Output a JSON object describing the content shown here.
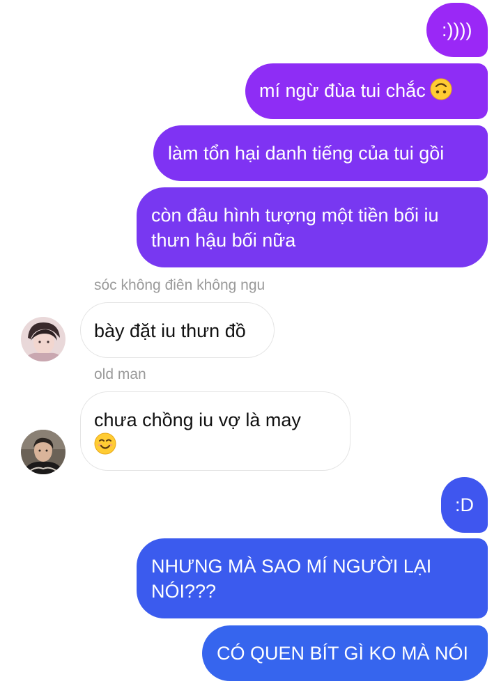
{
  "messages": [
    {
      "text": ":))))",
      "color": "#9a28f6"
    },
    {
      "text": "mí ngừ đùa tui chắc",
      "emoji": "upside-down-face",
      "color": "#8e2df5"
    },
    {
      "text": "làm tổn hại danh tiếng của tui gồi",
      "color": "#7f33f3"
    },
    {
      "text": "còn đâu hình tượng một tiền bối iu thưn hậu bối nữa",
      "color": "#7838f1"
    },
    {
      "sender": "sóc không điên không ngu",
      "text": "bày đặt iu thưn đồ",
      "avatar": "avatar-photo-1"
    },
    {
      "sender": "old man",
      "text": "chưa chồng iu vợ là may",
      "emoji": "smiling-face",
      "avatar": "avatar-photo-2"
    },
    {
      "text": ":D",
      "color": "#3f56ef"
    },
    {
      "text": "NHƯNG MÀ SAO MÍ NGƯỜI LẠI NÓI???",
      "color": "#3b5bee"
    },
    {
      "text": "CÓ QUEN BÍT GÌ KO MÀ NÓI",
      "color": "#3665ee"
    }
  ]
}
